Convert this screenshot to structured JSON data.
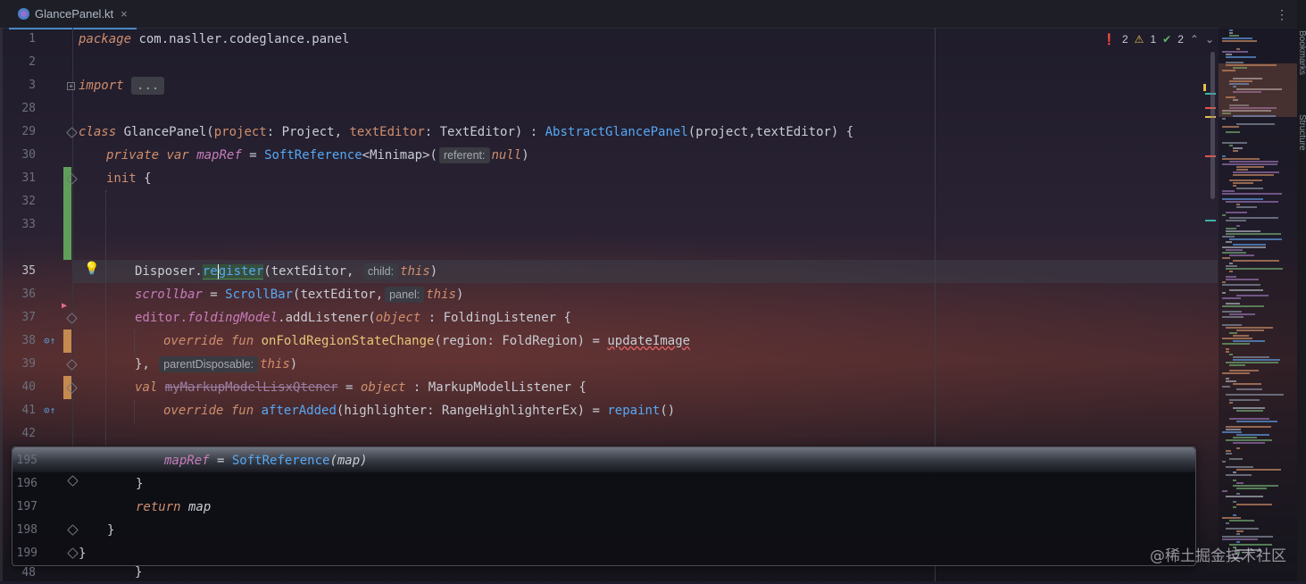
{
  "tab": {
    "file_name": "GlancePanel.kt",
    "close": "×",
    "more": "⋮"
  },
  "right_toolwindows": {
    "bookmarks": "Bookmarks",
    "structure": "Structure"
  },
  "inspections": {
    "errors": "2",
    "warnings": "1",
    "weak": "2",
    "up": "⌃",
    "down": "⌄"
  },
  "gutter": {
    "lines": [
      "1",
      "2",
      "3",
      "28",
      "29",
      "30",
      "31",
      "32",
      "33",
      "35",
      "36",
      "37",
      "38",
      "39",
      "40",
      "41",
      "42"
    ],
    "popup_lines": [
      "195",
      "196",
      "197",
      "198",
      "199",
      "48"
    ]
  },
  "code": {
    "l1_kw": "package",
    "l1_rest": " com.nasller.codeglance.panel",
    "l3_kw": "import",
    "l3_fold": "...",
    "l29_kw": "class",
    "l29_name": " GlancePanel(",
    "l29_p1": "project",
    "l29_t1": ": Project, ",
    "l29_p2": "textEditor",
    "l29_t2": ": TextEditor) : ",
    "l29_super": "AbstractGlancePanel",
    "l29_args": "(project,textEditor) {",
    "l30_kw1": "private",
    "l30_kw2": "var",
    "l30_name": "mapRef",
    "l30_eq": " = ",
    "l30_cls": "SoftReference",
    "l30_gen": "<Minimap>(",
    "l30_hint": "referent:",
    "l30_null": "null",
    "l30_close": ")",
    "l31_kw": "init",
    "l31_brace": " {",
    "l35_obj": "Disposer.",
    "l35_fn_a": "re",
    "l35_fn_b": "gister",
    "l35_args": "(textEditor,",
    "l35_hint": "child:",
    "l35_this": "this",
    "l35_close": ")",
    "l36_prop": "scrollbar",
    "l36_eq": " = ",
    "l36_cls": "ScrollBar",
    "l36_args": "(textEditor,",
    "l36_hint": "panel:",
    "l36_this": "this",
    "l36_close": ")",
    "l37_obj": "editor.",
    "l37_prop": "foldingModel",
    "l37_dot": ".",
    "l37_fn": "addListener",
    "l37_paren": "(",
    "l37_kw": "object",
    "l37_rest": " : FoldingListener {",
    "l38_kw1": "override",
    "l38_kw2": "fun",
    "l38_fn": "onFoldRegionStateChange",
    "l38_p": "(region",
    "l38_t": ": FoldRegion) = ",
    "l38_call": "updateImage",
    "l39_close": "},",
    "l39_hint": "parentDisposable:",
    "l39_this": "this",
    "l39_paren": ")",
    "l40_kw": "val",
    "l40_name": "myMarkupModelLisxQtener",
    "l40_eq": " = ",
    "l40_kw2": "object",
    "l40_rest": " : MarkupModelListener {",
    "l41_kw1": "override",
    "l41_kw2": "fun",
    "l41_fn": "afterAdded",
    "l41_p": "(highlighter",
    "l41_t": ": RangeHighlighterEx) = ",
    "l41_call": "repaint",
    "l41_paren": "()"
  },
  "popup": {
    "l195_name": "mapRef",
    "l195_eq": " = ",
    "l195_fn": "SoftReference",
    "l195_arg": "(map)",
    "l196": "}",
    "l197_kw": "return",
    "l197_rest": " map",
    "l198": "}",
    "l199": "}",
    "l48": "}"
  },
  "watermark": "@稀土掘金技术社区"
}
